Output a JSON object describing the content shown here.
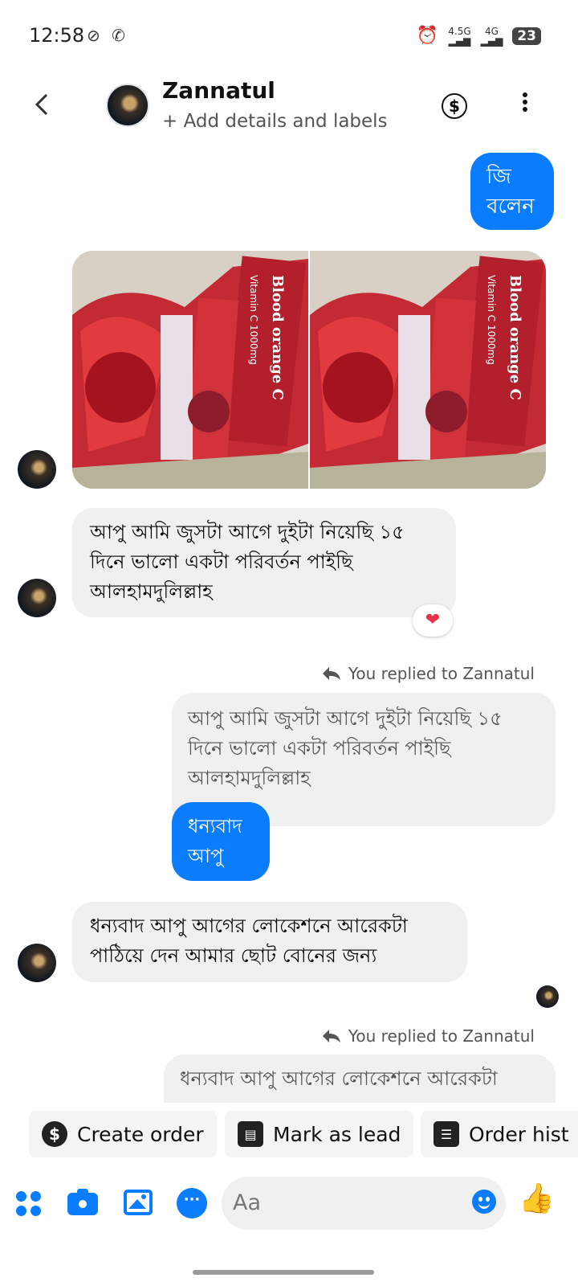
{
  "status_bar": {
    "time": "12:58",
    "network_1": "4.5G",
    "network_2": "4G",
    "battery": "23"
  },
  "header": {
    "contact_name": "Zannatul",
    "subtitle": "+ Add details and labels",
    "back_icon": "chevron-left-icon",
    "payment_icon": "dollar-circle-icon",
    "menu_icon": "more-vertical-icon"
  },
  "messages": [
    {
      "id": "m1",
      "direction": "outgoing",
      "text": "জি\nবলেন"
    },
    {
      "id": "m2",
      "direction": "incoming",
      "type": "photos",
      "count": 2
    },
    {
      "id": "m3",
      "direction": "incoming",
      "text": "আপু আমি জুসটা আগে দুইটা নিয়েছি ১৫\nদিনে ভালো একটা পরিবর্তন পাইছি\nআলহামদুলিল্লাহ",
      "reaction": "❤"
    },
    {
      "id": "m4",
      "direction": "outgoing",
      "reply_label": "You replied to Zannatul",
      "quoted": "আপু আমি জুসটা আগে দুইটা নিয়েছি ১৫\nদিনে ভালো একটা পরিবর্তন পাইছি\nআলহামদুলিল্লাহ",
      "text": "ধন্যবাদ\nআপু"
    },
    {
      "id": "m5",
      "direction": "incoming",
      "text": "ধন্যবাদ আপু আগের লোকেশনে আরেকটা\nপাঠিয়ে দেন আমার ছোট বোনের জন্য"
    },
    {
      "id": "m6",
      "direction": "outgoing",
      "reply_label": "You replied to Zannatul",
      "quoted": "ধন্যবাদ আপু আগের লোকেশনে আরেকটা"
    }
  ],
  "actions": {
    "create_order": "Create order",
    "mark_as_lead": "Mark as lead",
    "order_history": "Order hist"
  },
  "composer": {
    "placeholder": "Aa"
  },
  "colors": {
    "accent": "#0a7cff",
    "incoming_bubble": "#f0f0f0"
  }
}
